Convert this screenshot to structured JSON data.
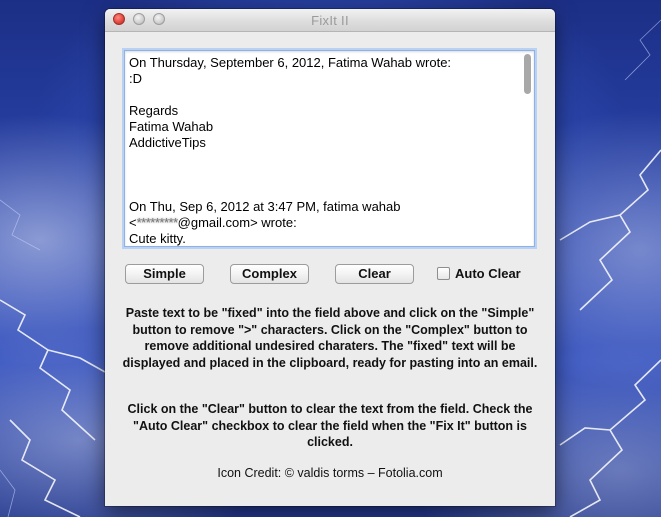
{
  "window": {
    "title": "FixIt II"
  },
  "textarea": {
    "lines": [
      "On Thursday, September 6, 2012, Fatima Wahab wrote:",
      ":D",
      "",
      "Regards",
      "Fatima Wahab",
      "AddictiveTips",
      "",
      "",
      "",
      "On Thu, Sep 6, 2012 at 3:47 PM, fatima wahab"
    ],
    "email_prefix": "<",
    "email_obscured": "*********",
    "email_suffix": "@gmail.com> wrote:",
    "last_line": "Cute kitty."
  },
  "buttons": {
    "simple": "Simple",
    "complex": "Complex",
    "clear": "Clear"
  },
  "auto_clear": {
    "label": "Auto Clear",
    "checked": false
  },
  "instructions": {
    "paragraph1": "Paste text to be \"fixed\" into the field above and click on the \"Simple\" button to remove \">\" characters.  Click on the \"Complex\" button to remove additional undesired charaters. The \"fixed\" text will be displayed and placed in the clipboard, ready for pasting into an email.",
    "paragraph2": "Click on the \"Clear\" button to clear the text from the field. Check the \"Auto Clear\" checkbox to clear the field when the \"Fix It\" button is clicked."
  },
  "credit": "Icon Credit:  © valdis torms – Fotolia.com",
  "colors": {
    "desktop_blue": "#2a45ad",
    "window_bg": "#ececec",
    "focus_ring": "#8fb1e6"
  }
}
